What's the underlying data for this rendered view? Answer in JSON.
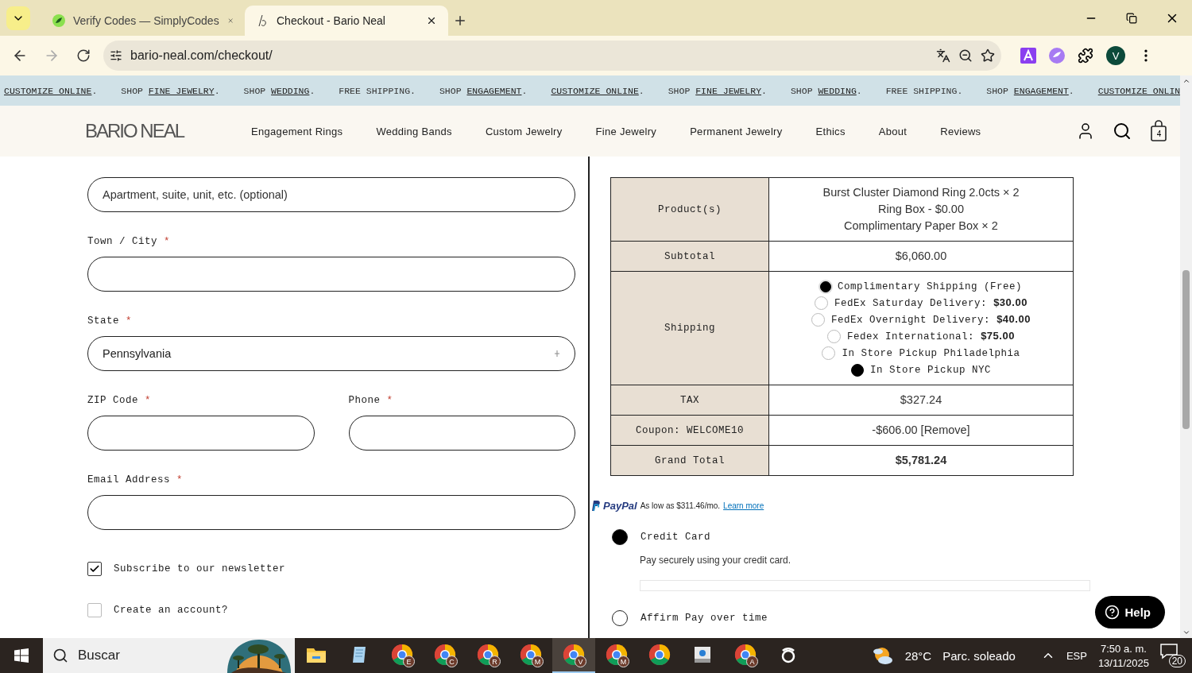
{
  "browser": {
    "tabs": [
      {
        "title": "Verify Codes — SimplyCodes",
        "selected": false
      },
      {
        "title": "Checkout - Bario Neal",
        "selected": true
      }
    ],
    "address": "bario-neal.com/checkout/",
    "profile_initial": "V"
  },
  "promo_bar": [
    {
      "link": "CUSTOMIZE ONLINE",
      "suffix": "."
    },
    {
      "prefix": "SHOP",
      "link": "FINE JEWELRY",
      "suffix": "."
    },
    {
      "prefix": "SHOP",
      "link": "WEDDING",
      "suffix": "."
    },
    {
      "prefix": "FREE SHIPPING."
    },
    {
      "prefix": "SHOP",
      "link": "ENGAGEMENT",
      "suffix": "."
    },
    {
      "link": "CUSTOMIZE ONLINE",
      "suffix": "."
    },
    {
      "prefix": "SHOP",
      "link": "FINE JEWELRY",
      "suffix": "."
    },
    {
      "prefix": "SHOP",
      "link": "WEDDING",
      "suffix": "."
    },
    {
      "prefix": "FREE SHIPPING."
    },
    {
      "prefix": "SHOP",
      "link": "ENGAGEMENT",
      "suffix": "."
    },
    {
      "link": "CUSTOMIZE ONLIN"
    }
  ],
  "header": {
    "logo": "BARIO NEAL",
    "nav": [
      "Engagement Rings",
      "Wedding Bands",
      "Custom Jewelry",
      "Fine Jewelry",
      "Permanent Jewelry",
      "Ethics",
      "About",
      "Reviews"
    ],
    "cart_count": "4"
  },
  "form": {
    "rows": [
      [
        {
          "kind": "text",
          "placeholder": "Apartment, suite, unit, etc. (optional)"
        }
      ],
      [
        {
          "kind": "text",
          "label": "Town / City",
          "required_mark": "*"
        }
      ],
      [
        {
          "kind": "select",
          "label": "State",
          "required_mark": "*",
          "value": "Pennsylvania"
        }
      ],
      [
        {
          "kind": "text",
          "label": "ZIP Code",
          "required_mark": "*"
        },
        {
          "kind": "text",
          "label": "Phone",
          "required_mark": "*"
        }
      ],
      [
        {
          "kind": "text",
          "label": "Email Address",
          "required_mark": "*"
        }
      ]
    ],
    "options": [
      {
        "label": "Subscribe to our newsletter",
        "checked": true
      },
      {
        "label": "Create an account?",
        "checked": false
      }
    ]
  },
  "order_summary": [
    {
      "kind": "lines",
      "label": "Product(s)",
      "lines": [
        "Burst Cluster Diamond Ring 2.0cts × 2",
        "Ring Box - $0.00",
        "Complimentary Paper Box × 2"
      ]
    },
    {
      "kind": "value",
      "label": "Subtotal",
      "value": "$6,060.00"
    },
    {
      "kind": "shipping",
      "label": "Shipping",
      "options": [
        {
          "label": "Complimentary Shipping (Free)",
          "selected": true
        },
        {
          "label": "FedEx Saturday Delivery:",
          "price": "$30.00",
          "selected": false
        },
        {
          "label": "FedEx Overnight Delivery:",
          "price": "$40.00",
          "selected": false
        },
        {
          "label": "Fedex International:",
          "price": "$75.00",
          "selected": false
        },
        {
          "label": "In Store Pickup Philadelphia",
          "selected": false
        },
        {
          "label": "In Store Pickup NYC",
          "selected": true
        }
      ]
    },
    {
      "kind": "value",
      "label": "TAX",
      "value": "$327.24"
    },
    {
      "kind": "value",
      "label": "Coupon: WELCOME10",
      "value": "-$606.00 [Remove]"
    },
    {
      "kind": "total",
      "label": "Grand Total",
      "value": "$5,781.24"
    }
  ],
  "paypal": {
    "logo": "PayPal",
    "message": "As low as $311.46/mo.",
    "link": "Learn more"
  },
  "payment_methods": [
    {
      "label": "Credit Card",
      "selected": true,
      "description": "Pay securely using your credit card."
    },
    {
      "label": "Affirm Pay over time",
      "selected": false
    }
  ],
  "help_button": "Help",
  "taskbar": {
    "search_placeholder": "Buscar",
    "apps": [
      {
        "kind": "folder",
        "selected": false
      },
      {
        "kind": "notepad",
        "selected": false
      },
      {
        "kind": "chrome",
        "badge": "E",
        "selected": false
      },
      {
        "kind": "chrome",
        "badge": "C",
        "selected": false
      },
      {
        "kind": "chrome",
        "badge": "R",
        "selected": false
      },
      {
        "kind": "chrome",
        "badge": "M",
        "selected": false
      },
      {
        "kind": "chrome",
        "badge": "V",
        "selected": true
      },
      {
        "kind": "chrome",
        "badge": "M",
        "selected": false
      },
      {
        "kind": "chrome",
        "selected": false
      },
      {
        "kind": "tool",
        "selected": false
      },
      {
        "kind": "chrome",
        "badge": "A",
        "selected": false
      },
      {
        "kind": "ring",
        "selected": false
      }
    ],
    "temperature": "28°C",
    "weather": "Parc. soleado",
    "language": "ESP",
    "time": "7:50 a. m.",
    "date": "13/11/2025",
    "notifications": "20"
  }
}
